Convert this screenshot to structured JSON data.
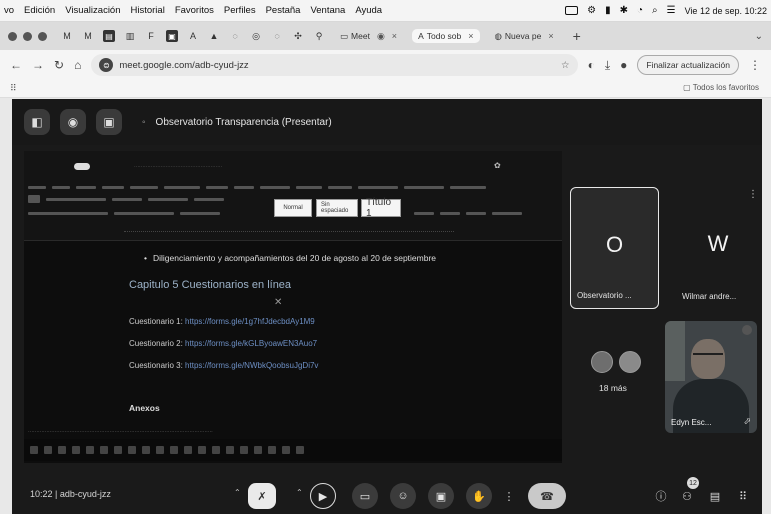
{
  "menubar": {
    "app": "vo",
    "items": [
      "Edición",
      "Visualización",
      "Historial",
      "Favoritos",
      "Perfiles",
      "Pestaña",
      "Ventana",
      "Ayuda"
    ],
    "datetime": "Vie 12 de sep. 10:22"
  },
  "tabs": [
    {
      "label": "Meet",
      "active": false
    },
    {
      "label": "Todo sob",
      "active": true
    },
    {
      "label": "Nueva pe",
      "active": false
    }
  ],
  "address": {
    "url": "meet.google.com/adb-cyud-jzz",
    "update_label": "Finalizar actualización"
  },
  "bookmarks": {
    "all": "Todos los favoritos"
  },
  "meet": {
    "title": "Observatorio Transparencia (Presentar)",
    "clock": "10:22",
    "code": "adb-cyud-jzz",
    "participants_count": "12"
  },
  "doc": {
    "style_normal": "Normal",
    "style_nospacing": "Sin espaciado",
    "style_title": "Título 1",
    "bullet": "Diligenciamiento y acompañamientos del 20 de agosto al 20 de septiembre",
    "chapter": "Capitulo 5 Cuestionarios en línea",
    "questionnaires": [
      {
        "label": "Cuestionario 1:",
        "link": "https://forms.gle/1g7hfJdecbdAy1M9"
      },
      {
        "label": "Cuestionario 2:",
        "link": "https://forms.gle/kGLByoawEN3Auo7"
      },
      {
        "label": "Cuestionario 3:",
        "link": "https://forms.gle/NWbkQoobsuJgDi7v"
      }
    ],
    "annex": "Anexos"
  },
  "participants": {
    "o_letter": "O",
    "o_name": "Observatorio ...",
    "w_letter": "W",
    "w_name": "Wilmar andre...",
    "more_label": "18 más",
    "edyn_name": "Edyn Esc..."
  },
  "icons": {
    "minimize": "wifi-icon",
    "screen-share": "present-icon",
    "more": "more-vert-icon"
  }
}
